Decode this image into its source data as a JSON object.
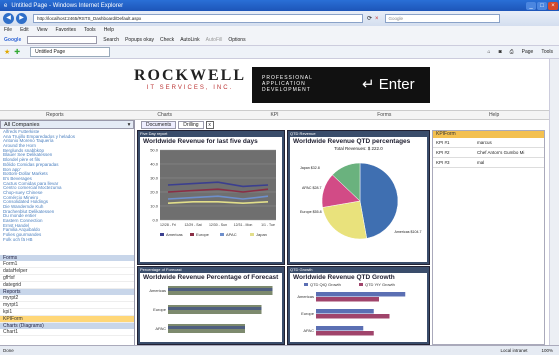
{
  "window": {
    "title": "Untitled Page - Windows Internet Explorer"
  },
  "address": {
    "url": "http://localhost:2465/RSTS_Dashboard/Default.aspx",
    "search_placeholder": "Google"
  },
  "menu": [
    "File",
    "Edit",
    "View",
    "Favorites",
    "Tools",
    "Help"
  ],
  "google_toolbar": {
    "label": "Google",
    "items": [
      "Search",
      "Popups okay",
      "Check",
      "AutoLink",
      "AutoFill",
      "Options"
    ]
  },
  "favorites": {
    "tab_label": "Untitled Page",
    "tools": [
      "Page",
      "Tools"
    ]
  },
  "banner": {
    "logo_big": "ROCKWELL",
    "logo_small": "IT SERVICES, INC.",
    "tagline": [
      "PROFESSIONAL",
      "APPLICATION",
      "DEVELOPMENT"
    ],
    "enter": "Enter"
  },
  "nav": [
    "Reports",
    "Charts",
    "KPI",
    "Forms",
    "Help"
  ],
  "left": {
    "companies_header": "All Companies",
    "companies": [
      "Alfreds Futterkiste",
      "Ana Trujillo Emparedados y helados",
      "Antonio Moreno Taquería",
      "Around the Horn",
      "Berglunds snabbköp",
      "Blauer See Delikatessen",
      "Blondel père et fils",
      "Bólido Comidas preparadas",
      "Bon app'",
      "Bottom-Dollar Markets",
      "B's Beverages",
      "Cactus Comidas para llevar",
      "Centro comercial Moctezuma",
      "Chop-suey Chinese",
      "Comércio Mineiro",
      "Consolidated Holdings",
      "Die Wandernde Kuh",
      "Drachenblut Delikatessen",
      "Du monde entier",
      "Eastern Connection",
      "Ernst Handel",
      "Familia Arquibaldo",
      "Folies gourmandes",
      "Folk och fä HB"
    ],
    "forms_header": "Forms",
    "forms": [
      "Form1",
      "dataHelper",
      "gfHxf",
      "dategrid"
    ],
    "reports_header": "Reports",
    "reports": [
      "myrpt2",
      "myrpt1",
      "kpi1"
    ],
    "kpi_selected": "KPIForm",
    "charts_header": "Charts (Diagrams)",
    "charts": [
      "Chart1"
    ]
  },
  "doc_tabs": {
    "documents": "Documents",
    "drilling": "Drilling",
    "close": "x"
  },
  "panels": {
    "p1": {
      "caption": "Five Day report",
      "title": "Worldwide Revenue for last five days"
    },
    "p2": {
      "caption": "QTD Revenue",
      "title": "Worldwide Revenue QTD percentages",
      "total": "Total Revenues: $ 222.0"
    },
    "p3": {
      "caption": "Percentage of Forecast",
      "title": "Worldwide Revenue Percentage of Forecast"
    },
    "p4": {
      "caption": "QTD Growth",
      "title": "Worldwide Revenue QTD Growth"
    }
  },
  "kpi": {
    "header": "KPIForm",
    "rows": [
      {
        "a": "KPI #1",
        "b": "marcus"
      },
      {
        "a": "KPI #2",
        "b": "Chef Anton's Gumbo Mi"
      },
      {
        "a": "KPI #3",
        "b": "mal"
      }
    ]
  },
  "status": {
    "left": "Done",
    "zone": "Local intranet",
    "zoom": "100%"
  },
  "chart_data": [
    {
      "type": "line",
      "title": "Worldwide Revenue for last five days",
      "x": [
        "12/28 - Fri",
        "12/29 - Sat",
        "12/30 - Sun",
        "12/31 - Mon",
        "1/1 - Tue"
      ],
      "ylim": [
        0,
        50
      ],
      "y_ticks": [
        "0.0",
        "10.0",
        "20.0",
        "30.0",
        "40.0",
        "50.0"
      ],
      "series": [
        {
          "name": "Americas",
          "color": "#3b3f8f",
          "values": [
            25,
            26,
            27,
            24,
            25
          ]
        },
        {
          "name": "Europe",
          "color": "#8a2e45",
          "values": [
            20,
            21,
            22,
            20,
            22
          ]
        },
        {
          "name": "APAC",
          "color": "#6e8fcc",
          "values": [
            15,
            16,
            17,
            15,
            17
          ]
        },
        {
          "name": "Japan",
          "color": "#e2de8a",
          "values": [
            12,
            13,
            13,
            12,
            13
          ]
        }
      ]
    },
    {
      "type": "pie",
      "title": "Worldwide Revenue QTD percentages",
      "slices": [
        {
          "label": "Americas $104.7",
          "color": "#3f6fb1",
          "value": 104.7
        },
        {
          "label": "Europe $55.8",
          "color": "#e9e27c",
          "value": 55.8
        },
        {
          "label": "Japan $32.8",
          "color": "#d24b86",
          "value": 32.8
        },
        {
          "label": "APAC $28.7",
          "color": "#6ab27e",
          "value": 28.7
        }
      ]
    },
    {
      "type": "bar",
      "title": "Worldwide Revenue Percentage of Forecast",
      "categories": [
        "Americas",
        "Europe",
        "APAC"
      ],
      "values": [
        95,
        85,
        70
      ]
    },
    {
      "type": "bar",
      "title": "Worldwide Revenue QTD Growth",
      "categories": [
        "Americas",
        "Europe",
        "APAC"
      ],
      "series": [
        {
          "name": "QTD QtQ Growth",
          "color": "#5b6fb3",
          "values": [
            85,
            55,
            45
          ]
        },
        {
          "name": "QTD YtY Growth",
          "color": "#a0446b",
          "values": [
            60,
            70,
            55
          ]
        }
      ]
    }
  ]
}
